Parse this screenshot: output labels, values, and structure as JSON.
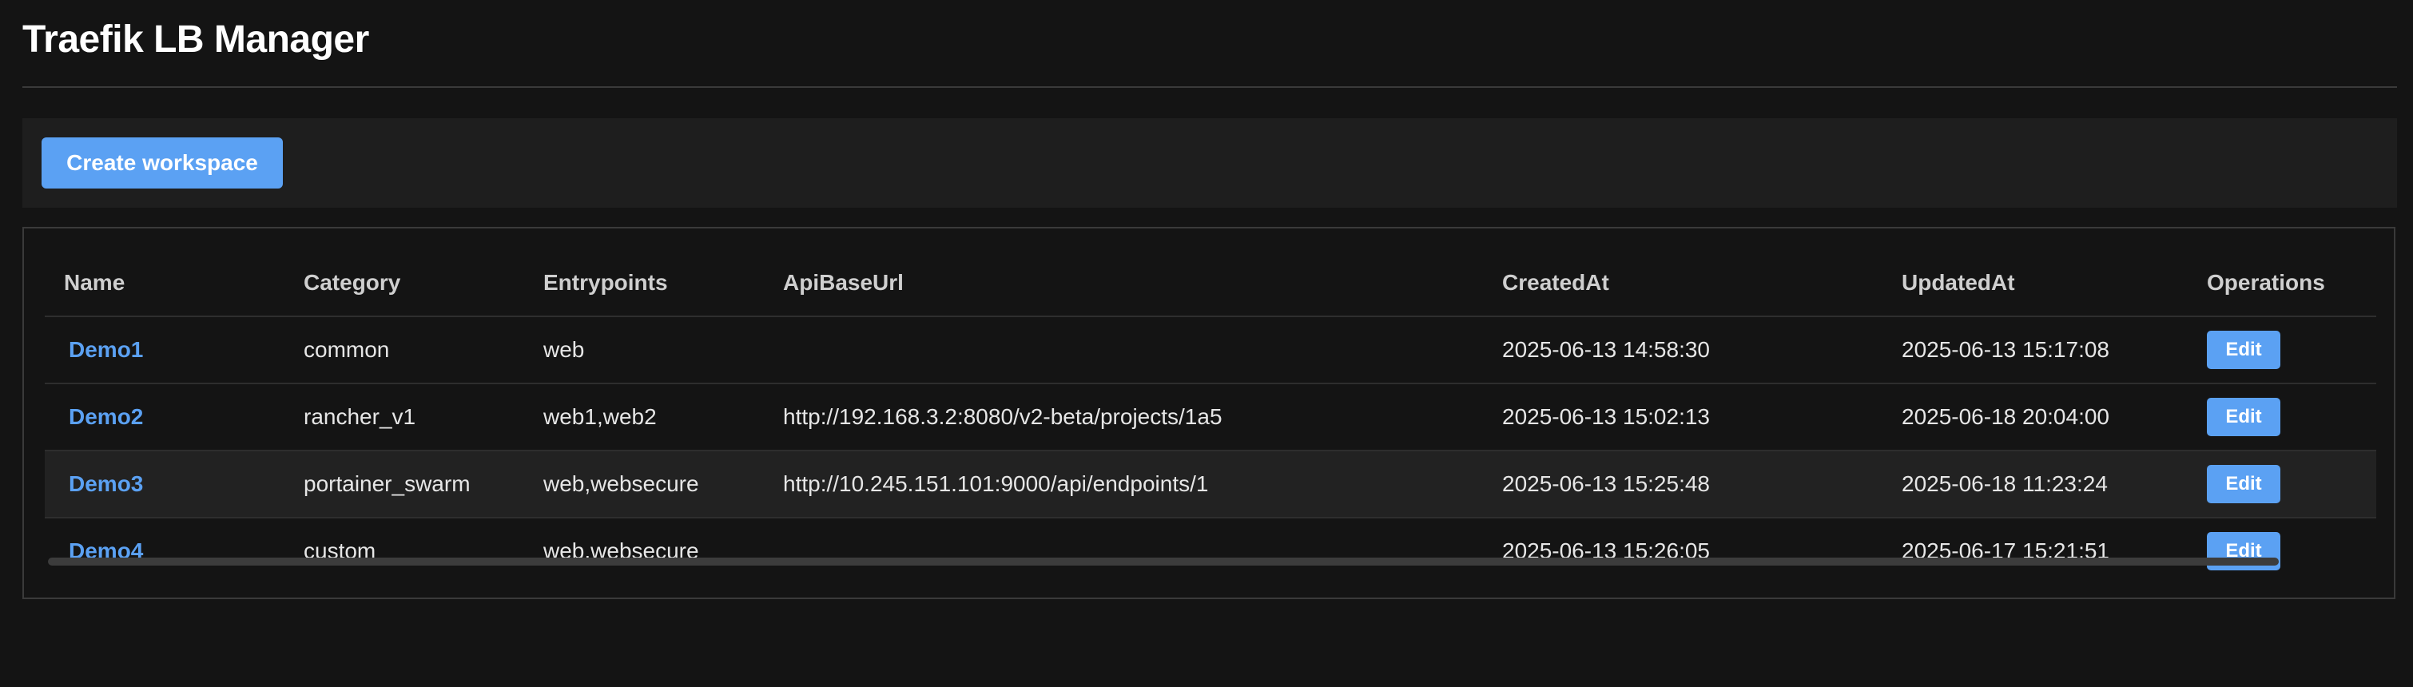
{
  "app": {
    "title": "Traefik LB Manager"
  },
  "toolbar": {
    "create_label": "Create workspace"
  },
  "table": {
    "headers": {
      "name": "Name",
      "category": "Category",
      "entrypoints": "Entrypoints",
      "api_base_url": "ApiBaseUrl",
      "created_at": "CreatedAt",
      "updated_at": "UpdatedAt",
      "operations": "Operations"
    },
    "rows": [
      {
        "name": "Demo1",
        "category": "common",
        "entrypoints": "web",
        "api_base_url": "",
        "created_at": "2025-06-13 14:58:30",
        "updated_at": "2025-06-13 15:17:08",
        "edit_label": "Edit"
      },
      {
        "name": "Demo2",
        "category": "rancher_v1",
        "entrypoints": "web1,web2",
        "api_base_url": "http://192.168.3.2:8080/v2-beta/projects/1a5",
        "created_at": "2025-06-13 15:02:13",
        "updated_at": "2025-06-18 20:04:00",
        "edit_label": "Edit"
      },
      {
        "name": "Demo3",
        "category": "portainer_swarm",
        "entrypoints": "web,websecure",
        "api_base_url": "http://10.245.151.101:9000/api/endpoints/1",
        "created_at": "2025-06-13 15:25:48",
        "updated_at": "2025-06-18 11:23:24",
        "edit_label": "Edit"
      },
      {
        "name": "Demo4",
        "category": "custom",
        "entrypoints": "web,websecure",
        "api_base_url": "",
        "created_at": "2025-06-13 15:26:05",
        "updated_at": "2025-06-17 15:21:51",
        "edit_label": "Edit"
      }
    ]
  },
  "colors": {
    "background": "#141414",
    "accent": "#5ba1f3",
    "panel": "#1e1e1e",
    "border": "#3a3a3a"
  }
}
